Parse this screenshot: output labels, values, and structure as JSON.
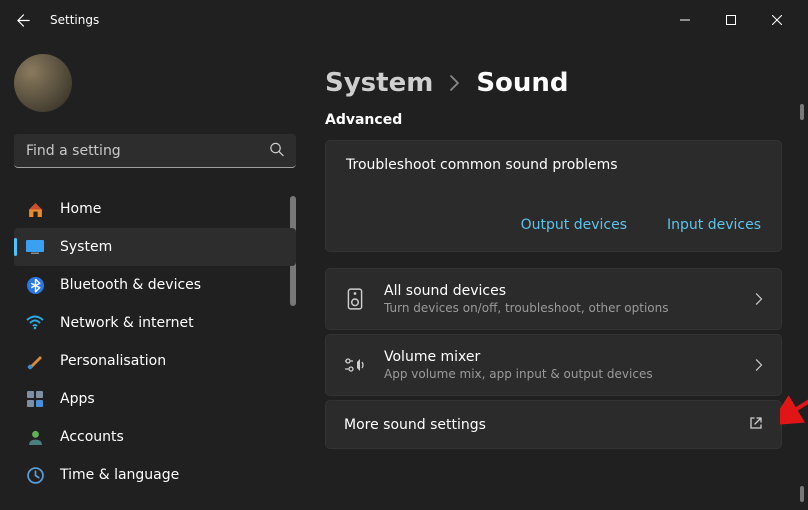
{
  "window": {
    "title": "Settings"
  },
  "search": {
    "placeholder": "Find a setting"
  },
  "nav": [
    {
      "label": "Home"
    },
    {
      "label": "System"
    },
    {
      "label": "Bluetooth & devices"
    },
    {
      "label": "Network & internet"
    },
    {
      "label": "Personalisation"
    },
    {
      "label": "Apps"
    },
    {
      "label": "Accounts"
    },
    {
      "label": "Time & language"
    }
  ],
  "breadcrumb": {
    "parent": "System",
    "current": "Sound"
  },
  "section": "Advanced",
  "troubleshoot": {
    "title": "Troubleshoot common sound problems",
    "output": "Output devices",
    "input": "Input devices"
  },
  "rows": {
    "allDevices": {
      "title": "All sound devices",
      "sub": "Turn devices on/off, troubleshoot, other options"
    },
    "mixer": {
      "title": "Volume mixer",
      "sub": "App volume mix, app input & output devices"
    },
    "more": {
      "title": "More sound settings"
    }
  }
}
